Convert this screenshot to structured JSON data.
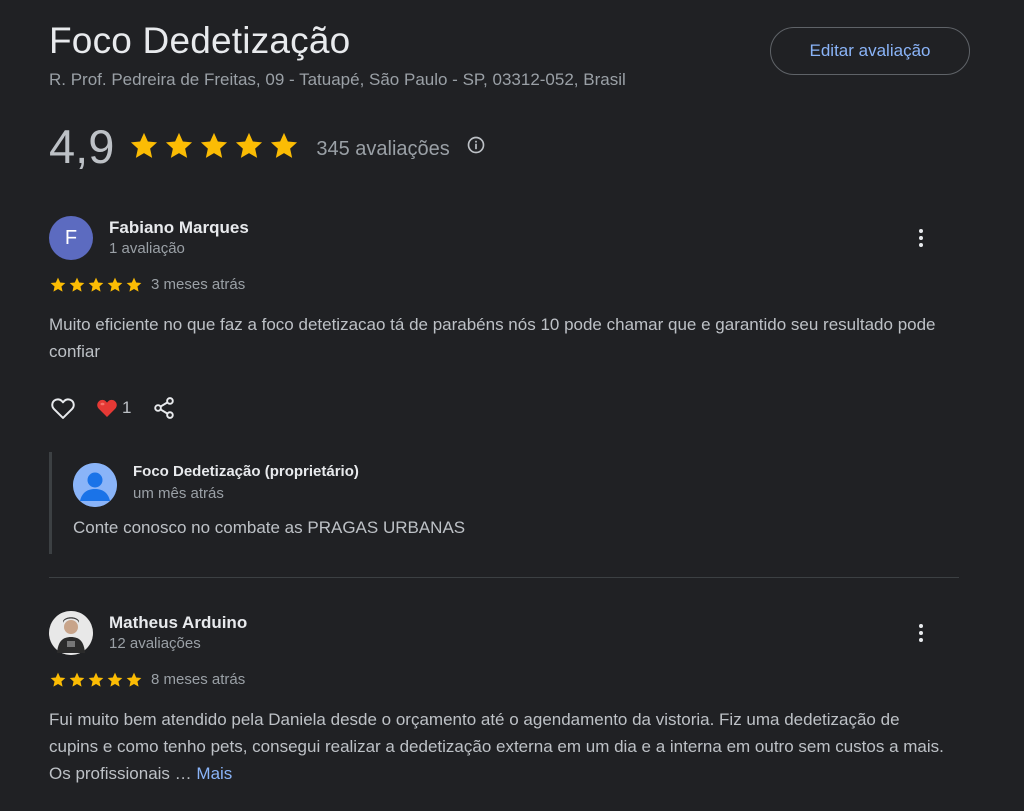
{
  "business": {
    "name": "Foco Dedetização",
    "address": "R. Prof. Pedreira de Freitas, 09 - Tatuapé, São Paulo - SP, 03312-052, Brasil",
    "edit_label": "Editar avaliação",
    "rating": "4,9",
    "rating_stars": 5,
    "review_count": "345 avaliações"
  },
  "colors": {
    "background": "#202124",
    "star": "#fbbc04",
    "link": "#8ab4f8",
    "heart": "#e53935"
  },
  "reviews": [
    {
      "avatar_letter": "F",
      "name": "Fabiano Marques",
      "count": "1 avaliação",
      "stars": 5,
      "when": "3 meses atrás",
      "text": "Muito eficiente no que faz a foco detetizacao tá de parabéns nós 10 pode chamar que e garantido seu resultado pode confiar",
      "reaction_count": "1",
      "reply": {
        "name": "Foco Dedetização (proprietário)",
        "when": "um mês atrás",
        "text": "Conte conosco no combate as PRAGAS URBANAS"
      }
    },
    {
      "name": "Matheus Arduino",
      "count": "12 avaliações",
      "stars": 5,
      "when": "8 meses atrás",
      "text": "Fui muito bem atendido pela Daniela desde o orçamento até o agendamento da vistoria. Fiz uma dedetização de cupins e como tenho pets, consegui realizar a dedetização externa em um dia e a interna em outro sem custos a mais. Os profissionais …",
      "more_label": "Mais"
    }
  ],
  "icons": {
    "star": "star-icon",
    "info": "info-icon",
    "more": "more-vert-icon",
    "like": "heart-outline-icon",
    "reaction": "heart-emoji-icon",
    "share": "share-icon",
    "owner_avatar": "person-avatar-icon"
  }
}
